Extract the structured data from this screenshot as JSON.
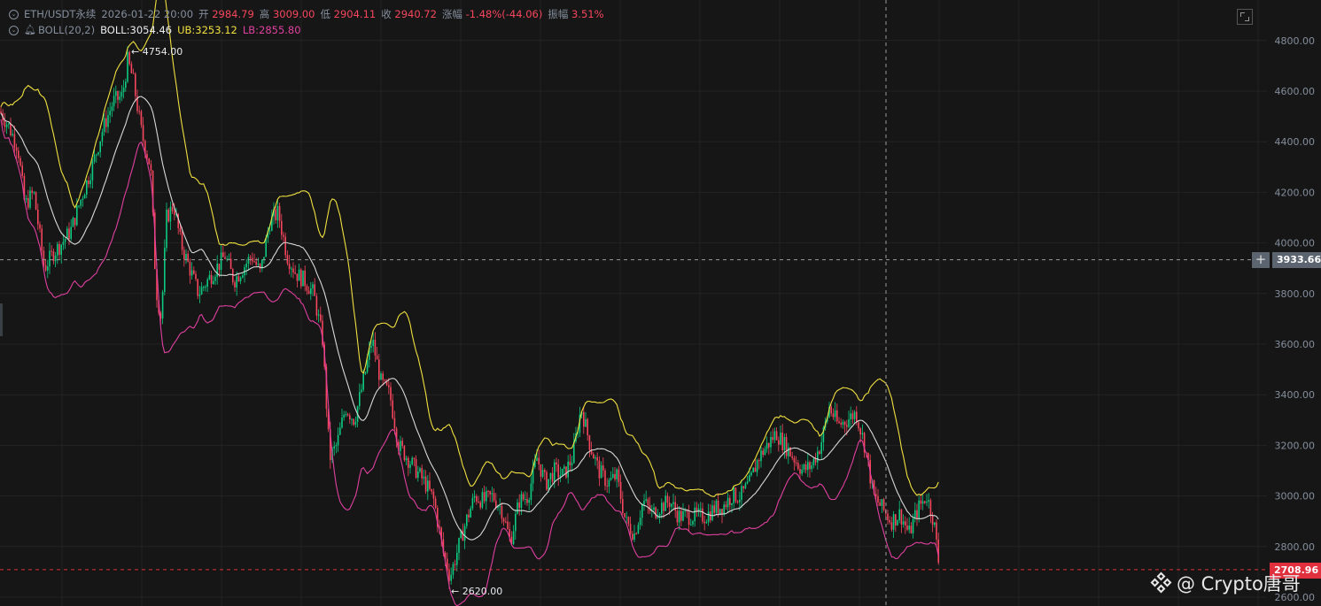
{
  "header": {
    "symbol": "ETH/USDT永续",
    "datetime": "2026-01-22 20:00",
    "open_label": "开",
    "open_value": "2984.79",
    "high_label": "高",
    "high_value": "3009.00",
    "low_label": "低",
    "low_value": "2904.11",
    "close_label": "收",
    "close_value": "2940.72",
    "change_label": "涨幅",
    "change_value": "-1.48%(-44.06)",
    "amplitude_label": "振幅",
    "amplitude_value": "3.51%",
    "boll_name": "BOLL(20,2)",
    "boll_mid": "BOLL:3054.46",
    "boll_ub": "UB:3253.12",
    "boll_lb": "LB:2855.80"
  },
  "crosshair_price": "3933.66",
  "last_price": "2708.96",
  "watermark": "@ Crypto唐哥",
  "colors": {
    "up": "#0ecb81",
    "down": "#f6465d",
    "boll_mid": "#d8d8d8",
    "boll_ub": "#f0e040",
    "boll_lb": "#e040a0"
  },
  "chart_data": {
    "type": "candlestick",
    "symbol": "ETH/USDT永续",
    "y_axis_ticks": [
      "4800.00",
      "4600.00",
      "4400.00",
      "4200.00",
      "4000.00",
      "3800.00",
      "3600.00",
      "3400.00",
      "3200.00",
      "3000.00",
      "2800.00",
      "2600.00"
    ],
    "ylim": [
      2580,
      4905
    ],
    "grid": true,
    "annotations": [
      {
        "label": "4754.00",
        "type": "high",
        "value": 4754
      },
      {
        "label": "2620.00",
        "type": "low",
        "value": 2620
      }
    ],
    "crosshair_value": 3933.66,
    "last_value": 2708.96,
    "series_path": [
      [
        0,
        4520
      ],
      [
        10,
        4460
      ],
      [
        20,
        4380
      ],
      [
        28,
        4150
      ],
      [
        38,
        4200
      ],
      [
        50,
        3900
      ],
      [
        60,
        3960
      ],
      [
        70,
        4000
      ],
      [
        80,
        4050
      ],
      [
        92,
        4180
      ],
      [
        104,
        4300
      ],
      [
        116,
        4450
      ],
      [
        128,
        4560
      ],
      [
        138,
        4580
      ],
      [
        144,
        4720
      ],
      [
        150,
        4650
      ],
      [
        160,
        4430
      ],
      [
        170,
        4300
      ],
      [
        176,
        3820
      ],
      [
        182,
        3700
      ],
      [
        188,
        4100
      ],
      [
        196,
        4150
      ],
      [
        204,
        4000
      ],
      [
        214,
        3900
      ],
      [
        224,
        3800
      ],
      [
        234,
        3850
      ],
      [
        244,
        3900
      ],
      [
        254,
        3950
      ],
      [
        264,
        3850
      ],
      [
        274,
        3900
      ],
      [
        284,
        3950
      ],
      [
        294,
        3880
      ],
      [
        304,
        4080
      ],
      [
        314,
        4120
      ],
      [
        324,
        3950
      ],
      [
        334,
        3880
      ],
      [
        344,
        3850
      ],
      [
        354,
        3800
      ],
      [
        364,
        3620
      ],
      [
        372,
        3150
      ],
      [
        380,
        3200
      ],
      [
        390,
        3350
      ],
      [
        400,
        3300
      ],
      [
        410,
        3450
      ],
      [
        420,
        3620
      ],
      [
        430,
        3450
      ],
      [
        440,
        3400
      ],
      [
        450,
        3200
      ],
      [
        460,
        3150
      ],
      [
        470,
        3100
      ],
      [
        480,
        3050
      ],
      [
        490,
        2980
      ],
      [
        500,
        2780
      ],
      [
        508,
        2680
      ],
      [
        516,
        2780
      ],
      [
        526,
        2900
      ],
      [
        536,
        3000
      ],
      [
        546,
        2980
      ],
      [
        556,
        3000
      ],
      [
        566,
        2950
      ],
      [
        576,
        2820
      ],
      [
        586,
        2980
      ],
      [
        596,
        3000
      ],
      [
        606,
        3150
      ],
      [
        616,
        3050
      ],
      [
        626,
        3100
      ],
      [
        636,
        3080
      ],
      [
        646,
        3150
      ],
      [
        656,
        3350
      ],
      [
        666,
        3200
      ],
      [
        676,
        3100
      ],
      [
        686,
        3050
      ],
      [
        696,
        3080
      ],
      [
        706,
        2900
      ],
      [
        716,
        2850
      ],
      [
        726,
        2980
      ],
      [
        736,
        2930
      ],
      [
        746,
        2960
      ],
      [
        756,
        2980
      ],
      [
        766,
        2920
      ],
      [
        776,
        2920
      ],
      [
        786,
        2920
      ],
      [
        796,
        2920
      ],
      [
        806,
        2950
      ],
      [
        816,
        2960
      ],
      [
        826,
        3000
      ],
      [
        836,
        3000
      ],
      [
        846,
        3050
      ],
      [
        856,
        3150
      ],
      [
        866,
        3200
      ],
      [
        876,
        3250
      ],
      [
        886,
        3200
      ],
      [
        896,
        3150
      ],
      [
        906,
        3100
      ],
      [
        916,
        3120
      ],
      [
        926,
        3200
      ],
      [
        936,
        3350
      ],
      [
        946,
        3280
      ],
      [
        956,
        3300
      ],
      [
        966,
        3330
      ],
      [
        976,
        3200
      ],
      [
        986,
        3000
      ],
      [
        996,
        2950
      ],
      [
        1006,
        2900
      ],
      [
        1016,
        2930
      ],
      [
        1026,
        2850
      ],
      [
        1036,
        2950
      ],
      [
        1046,
        3000
      ],
      [
        1054,
        2900
      ],
      [
        1060,
        2720
      ]
    ]
  }
}
